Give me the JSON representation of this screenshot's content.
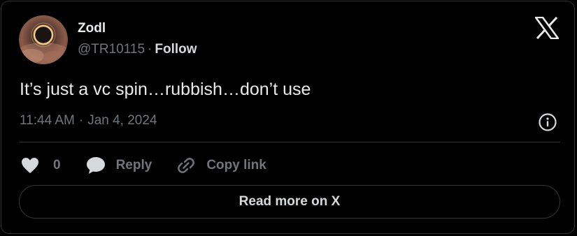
{
  "author": {
    "name": "Zodl",
    "handle": "@TR10115",
    "separator": "·",
    "follow_label": "Follow"
  },
  "tweet": {
    "text": "It’s just a vc spin…rubbish…don’t use",
    "time": "11:44 AM",
    "separator": "·",
    "date": "Jan 4, 2024"
  },
  "actions": {
    "like_count": "0",
    "reply_label": "Reply",
    "copy_link_label": "Copy link"
  },
  "read_more_label": "Read more on X",
  "icons": {
    "brand": "x-logo-icon",
    "info": "info-icon",
    "like": "heart-icon",
    "reply": "speech-bubble-icon",
    "copy": "link-icon"
  },
  "colors": {
    "background": "#000000",
    "text_primary": "#e7e9ea",
    "text_secondary": "#71767b",
    "border": "#2f3336"
  }
}
